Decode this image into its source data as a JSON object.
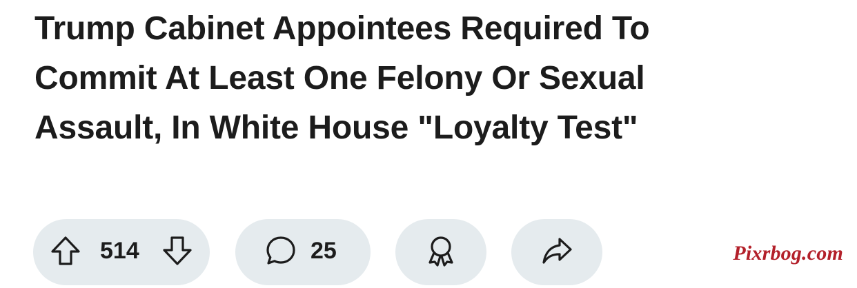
{
  "post": {
    "title": "Trump Cabinet Appointees Required To Commit At Least One Felony Or Sexual Assault, In White House \"Loyalty Test\""
  },
  "actions": {
    "vote_count": "514",
    "comment_count": "25",
    "icons": {
      "upvote": "arrow-up-icon",
      "downvote": "arrow-down-icon",
      "comment": "speech-bubble-icon",
      "award": "award-ribbon-icon",
      "share": "share-arrow-icon"
    }
  },
  "watermark": {
    "text": "Pixrbog.com",
    "color": "#b3202a"
  },
  "colors": {
    "pill_background": "#e5ebee",
    "text": "#1c1c1c",
    "background": "#ffffff"
  }
}
